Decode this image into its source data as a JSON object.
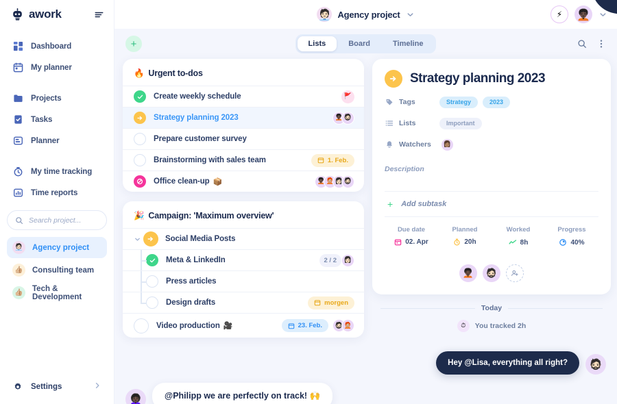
{
  "brand": {
    "name": "awork",
    "logo_icon": "robot-logo-icon",
    "collapse_icon": "collapse-menu-icon"
  },
  "sidebar": {
    "nav_groups": [
      {
        "items": [
          {
            "label": "Dashboard",
            "icon": "dashboard-icon"
          },
          {
            "label": "My planner",
            "icon": "calendar-icon"
          }
        ]
      },
      {
        "items": [
          {
            "label": "Projects",
            "icon": "folder-icon"
          },
          {
            "label": "Tasks",
            "icon": "task-check-icon"
          },
          {
            "label": "Planner",
            "icon": "planner-board-icon"
          }
        ]
      },
      {
        "items": [
          {
            "label": "My time tracking",
            "icon": "stopwatch-icon"
          },
          {
            "label": "Time reports",
            "icon": "bar-report-icon"
          }
        ]
      }
    ],
    "search": {
      "placeholder": "Search project...",
      "value": "",
      "icon": "search-icon"
    },
    "projects": [
      {
        "label": "Agency project",
        "avatar": "🧑🏻‍💼",
        "avatar_bg": "#f2ddf1",
        "active": true
      },
      {
        "label": "Consulting team",
        "avatar": "👍🏼",
        "avatar_bg": "#fdf0d9",
        "active": false
      },
      {
        "label": "Tech & Development",
        "avatar": "👍🏼",
        "avatar_bg": "#d9f5e6",
        "active": false
      }
    ],
    "settings": {
      "label": "Settings",
      "icon": "gear-icon",
      "chevron": "chevron-right-icon"
    }
  },
  "topbar": {
    "project_name": "Agency project",
    "project_avatar": "🧑🏻‍💼",
    "project_chevron": "chevron-down-icon",
    "bolt_icon": "lightning-bolt-icon",
    "user_avatar": "🧑🏿‍🦱",
    "user_chevron": "chevron-down-icon"
  },
  "toolbar": {
    "add_label": "+",
    "tabs": [
      {
        "label": "Lists",
        "active": true
      },
      {
        "label": "Board",
        "active": false
      },
      {
        "label": "Timeline",
        "active": false
      }
    ],
    "search_icon": "search-icon",
    "more_icon": "more-vertical-icon"
  },
  "urgent_card": {
    "emoji": "🔥",
    "title": "Urgent to-dos",
    "rows": [
      {
        "status": "done",
        "label": "Create weekly schedule",
        "emoji": "",
        "selected": false,
        "flag": "🚩",
        "avatars": [],
        "pill": null
      },
      {
        "status": "prog",
        "label": "Strategy planning 2023",
        "emoji": "",
        "selected": true,
        "flag": null,
        "avatars": [
          "🧑🏿‍🦱",
          "🧔🏻"
        ],
        "pill": null
      },
      {
        "status": "open",
        "label": "Prepare customer survey",
        "emoji": "",
        "selected": false,
        "flag": null,
        "avatars": [],
        "pill": null
      },
      {
        "status": "open",
        "label": "Brainstorming with sales team",
        "emoji": "",
        "selected": false,
        "flag": null,
        "avatars": [],
        "pill": {
          "text": "1. Feb.",
          "tone": "amber",
          "icon": "calendar-icon"
        }
      },
      {
        "status": "block",
        "label": "Office clean-up",
        "emoji": "📦",
        "selected": false,
        "flag": null,
        "avatars": [
          "🧑🏿‍🦱",
          "🧑🏼‍🦰",
          "👩🏻",
          "🧔🏻"
        ],
        "pill": null
      }
    ]
  },
  "campaign_card": {
    "emoji": "🎉",
    "title": "Campaign: 'Maximum overview'",
    "parent": {
      "status": "prog",
      "label": "Social Media Posts",
      "caret": "chevron-down-icon"
    },
    "subtasks": [
      {
        "status": "done",
        "label": "Meta & LinkedIn",
        "count": "2 / 2",
        "avatars": [
          "👩🏻"
        ],
        "pill": null
      },
      {
        "status": "open",
        "label": "Press articles",
        "count": null,
        "avatars": [],
        "pill": null
      },
      {
        "status": "open",
        "label": "Design drafts",
        "count": null,
        "avatars": [],
        "pill": {
          "text": "morgen",
          "tone": "amber",
          "icon": "calendar-icon"
        }
      }
    ],
    "footer_row": {
      "status": "open",
      "label": "Video production",
      "emoji": "🎥",
      "pill": {
        "text": "23. Feb.",
        "tone": "blue",
        "icon": "calendar-icon"
      },
      "avatars": [
        "🧔🏻",
        "🧑🏼‍🦰"
      ]
    }
  },
  "detail": {
    "status_icon": "arrow-right-status-icon",
    "title": "Strategy planning 2023",
    "meta": [
      {
        "icon": "tag-icon",
        "label": "Tags",
        "chips": [
          {
            "text": "Strategy",
            "tone": "cyan"
          },
          {
            "text": "2023",
            "tone": "cyan"
          }
        ],
        "avatars": []
      },
      {
        "icon": "list-icon",
        "label": "Lists",
        "chips": [
          {
            "text": "Important",
            "tone": "grey"
          }
        ],
        "avatars": []
      },
      {
        "icon": "bell-icon",
        "label": "Watchers",
        "chips": [],
        "avatars": [
          "👩🏽"
        ]
      }
    ],
    "description_placeholder": "Description",
    "add_subtask": {
      "plus": "+",
      "label": "Add subtask"
    },
    "stats": [
      {
        "label": "Due date",
        "value": "02. Apr",
        "icon": "calendar-pink-icon"
      },
      {
        "label": "Planned",
        "value": "20h",
        "icon": "stopwatch-amber-icon"
      },
      {
        "label": "Worked",
        "value": "8h",
        "icon": "trend-green-icon"
      },
      {
        "label": "Progress",
        "value": "40%",
        "icon": "progress-clock-icon"
      }
    ],
    "members": [
      "🧑🏿‍🦱",
      "🧔🏻"
    ],
    "add_member_icon": "add-person-icon"
  },
  "activity": {
    "day_label": "Today",
    "tracked": {
      "icon": "stopwatch-icon",
      "text": "You tracked 2h"
    },
    "messages": [
      {
        "side": "right",
        "text_pre": "Hey ",
        "mention": "@Lisa",
        "text_post": ", everything all right?",
        "avatar": "🧔🏻"
      },
      {
        "side": "left",
        "text_pre": "",
        "mention": "@Philipp",
        "text_post": " we are perfectly on track! 🙌",
        "avatar": "👩🏿‍🦱"
      }
    ]
  },
  "colors": {
    "bg": "#f4f6fd",
    "accent_blue": "#3b97f7",
    "green": "#3ed68a",
    "amber": "#fcc44c",
    "pink": "#f5349b",
    "navy": "#1b2a4e"
  }
}
